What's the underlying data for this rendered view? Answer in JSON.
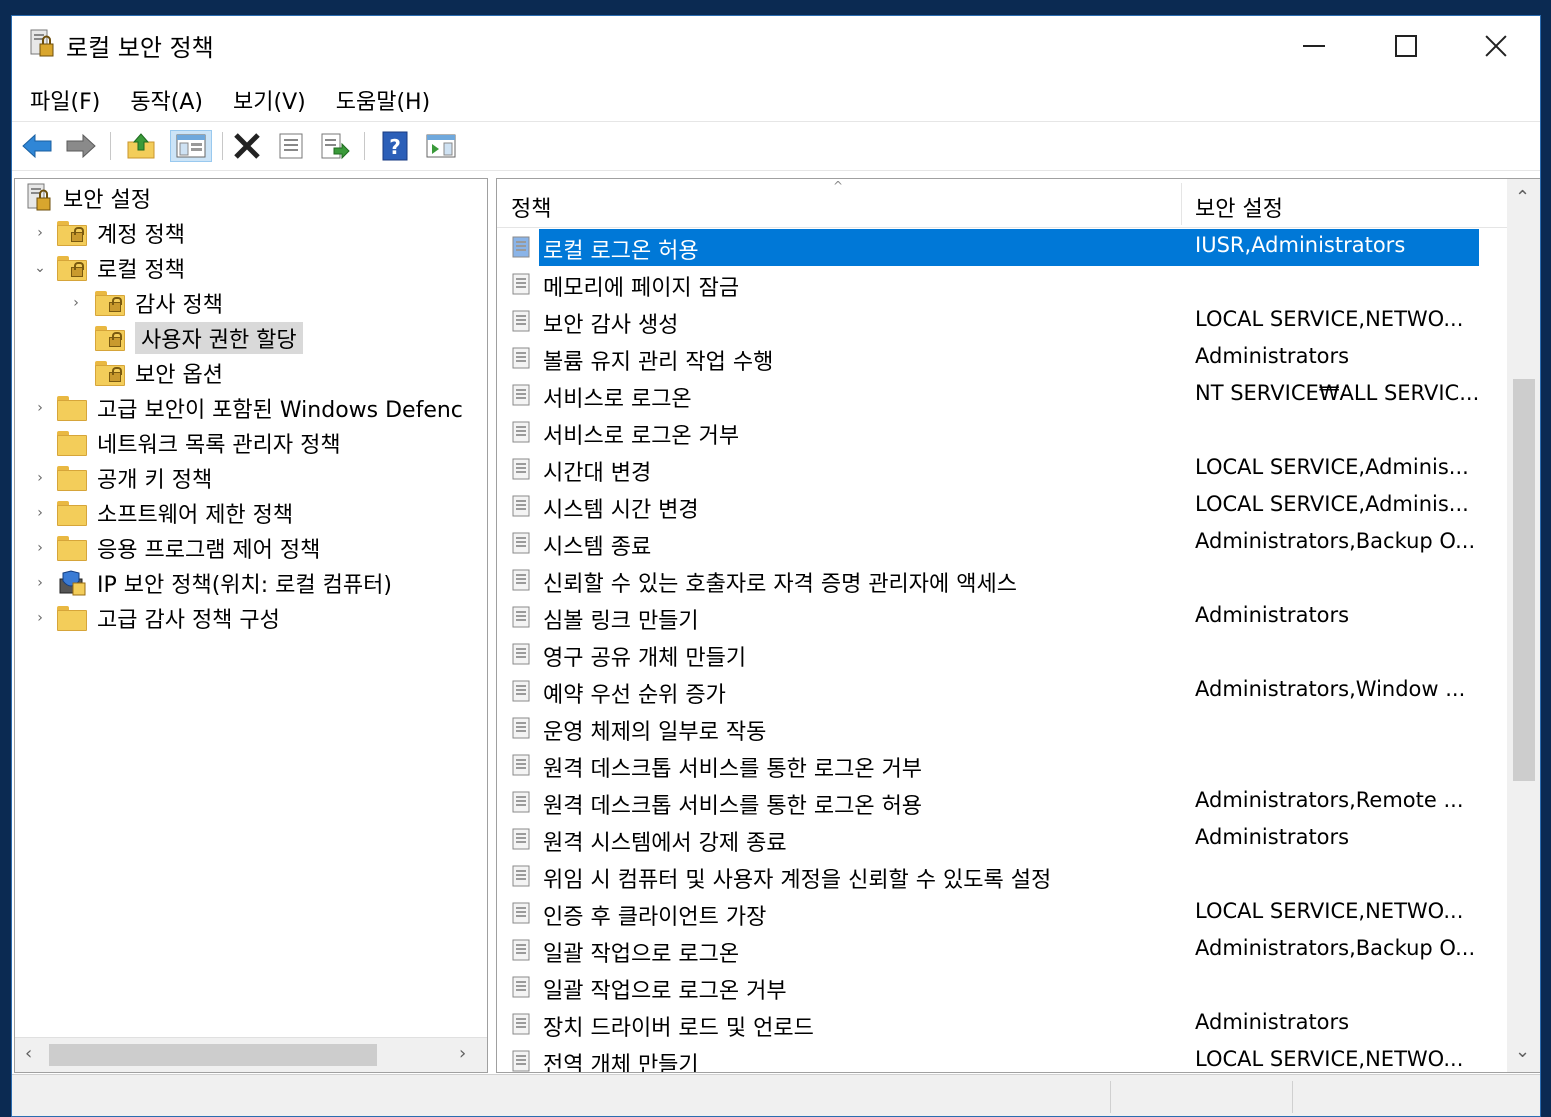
{
  "window": {
    "title": "로컬 보안 정책",
    "colors": {
      "selection": "#0078d7",
      "folder": "#f3cd5a"
    }
  },
  "menu": [
    {
      "label": "파일(F)"
    },
    {
      "label": "동작(A)"
    },
    {
      "label": "보기(V)"
    },
    {
      "label": "도움말(H)"
    }
  ],
  "toolbar": [
    "back-icon",
    "forward-icon",
    "up-folder-icon",
    "show-hide-tree-icon",
    "delete-icon",
    "properties-icon",
    "export-list-icon",
    "help-icon",
    "action-pane-icon"
  ],
  "tree": {
    "root": "보안 설정",
    "items": [
      {
        "label": "계정 정책"
      },
      {
        "label": "로컬 정책"
      },
      {
        "label": "감사 정책"
      },
      {
        "label": "사용자 권한 할당"
      },
      {
        "label": "보안 옵션"
      },
      {
        "label": "고급 보안이 포함된 Windows Defenc"
      },
      {
        "label": "네트워크 목록 관리자 정책"
      },
      {
        "label": "공개 키 정책"
      },
      {
        "label": "소프트웨어 제한 정책"
      },
      {
        "label": "응용 프로그램 제어 정책"
      },
      {
        "label": "IP 보안 정책(위치: 로컬 컴퓨터)"
      },
      {
        "label": "고급 감사 정책 구성"
      }
    ]
  },
  "list": {
    "columns": {
      "policy": "정책",
      "setting": "보안 설정"
    },
    "rows": [
      {
        "policy": "로컬 로그온 허용",
        "setting": "IUSR,Administrators"
      },
      {
        "policy": "메모리에 페이지 잠금",
        "setting": ""
      },
      {
        "policy": "보안 감사 생성",
        "setting": "LOCAL SERVICE,NETWO..."
      },
      {
        "policy": "볼륨 유지 관리 작업 수행",
        "setting": "Administrators"
      },
      {
        "policy": "서비스로 로그온",
        "setting": "NT SERVICE₩ALL SERVIC..."
      },
      {
        "policy": "서비스로 로그온 거부",
        "setting": ""
      },
      {
        "policy": "시간대 변경",
        "setting": "LOCAL SERVICE,Adminis..."
      },
      {
        "policy": "시스템 시간 변경",
        "setting": "LOCAL SERVICE,Adminis..."
      },
      {
        "policy": "시스템 종료",
        "setting": "Administrators,Backup O..."
      },
      {
        "policy": "신뢰할 수 있는 호출자로 자격 증명 관리자에 액세스",
        "setting": ""
      },
      {
        "policy": "심볼 링크 만들기",
        "setting": "Administrators"
      },
      {
        "policy": "영구 공유 개체 만들기",
        "setting": ""
      },
      {
        "policy": "예약 우선 순위 증가",
        "setting": "Administrators,Window ..."
      },
      {
        "policy": "운영 체제의 일부로 작동",
        "setting": ""
      },
      {
        "policy": "원격 데스크톱 서비스를 통한 로그온 거부",
        "setting": ""
      },
      {
        "policy": "원격 데스크톱 서비스를 통한 로그온 허용",
        "setting": "Administrators,Remote ..."
      },
      {
        "policy": "원격 시스템에서 강제 종료",
        "setting": "Administrators"
      },
      {
        "policy": "위임 시 컴퓨터 및 사용자 계정을 신뢰할 수 있도록 설정",
        "setting": ""
      },
      {
        "policy": "인증 후 클라이언트 가장",
        "setting": "LOCAL SERVICE,NETWO..."
      },
      {
        "policy": "일괄 작업으로 로그온",
        "setting": "Administrators,Backup O..."
      },
      {
        "policy": "일괄 작업으로 로그온 거부",
        "setting": ""
      },
      {
        "policy": "장치 드라이버 로드 및 언로드",
        "setting": "Administrators"
      },
      {
        "policy": "전역 개체 만들기",
        "setting": "LOCAL SERVICE,NETWO..."
      }
    ]
  }
}
